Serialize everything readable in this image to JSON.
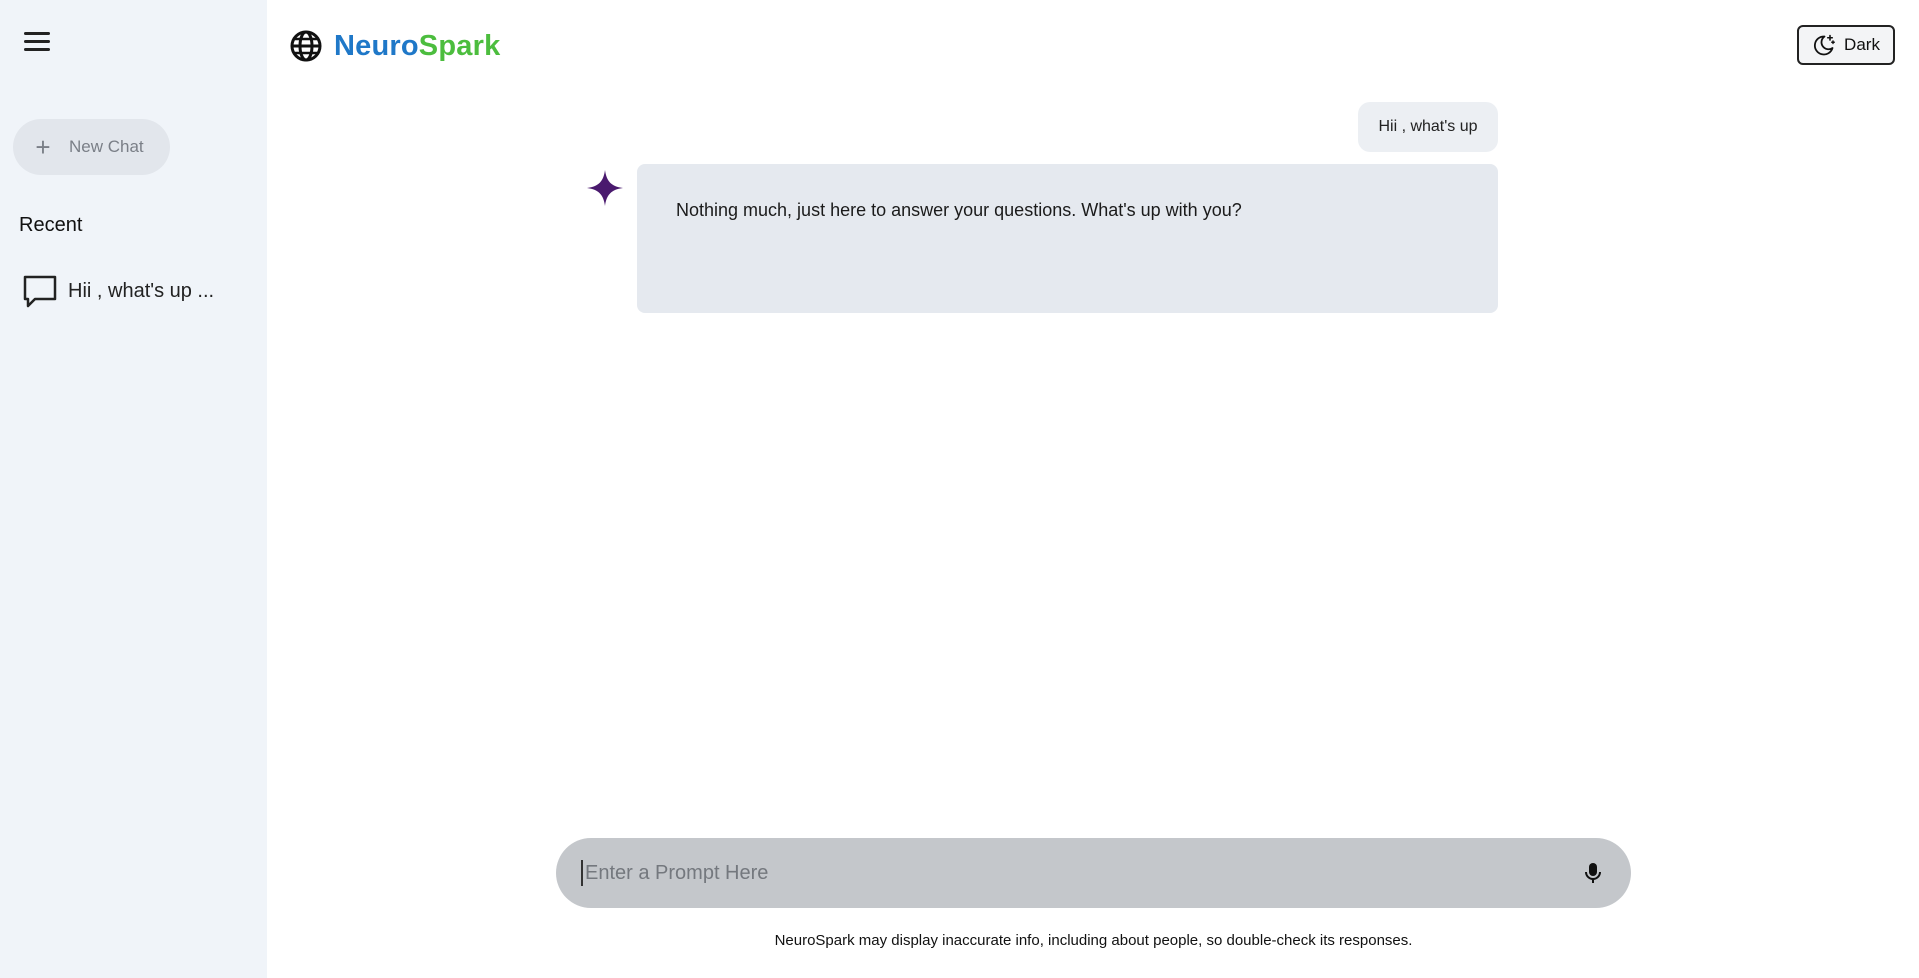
{
  "sidebar": {
    "new_chat_label": "New Chat",
    "recent_title": "Recent",
    "recent_items": [
      {
        "label": "Hii , what's up ..."
      }
    ]
  },
  "header": {
    "brand_part1": "Neuro",
    "brand_part2": "Spark",
    "theme_toggle_label": "Dark"
  },
  "chat": {
    "user_message": "Hii , what's up",
    "bot_message": "Nothing much, just here to answer your questions. What's up with you?"
  },
  "prompt": {
    "placeholder": "Enter a Prompt Here",
    "value": ""
  },
  "footer": {
    "disclaimer": "NeuroSpark may display inaccurate info, including about people, so double-check its responses."
  },
  "colors": {
    "brand_blue": "#1f78c8",
    "brand_green": "#4cbd3e",
    "sidebar_bg": "#f0f4f9",
    "bot_bubble_bg": "#e5e9ef",
    "prompt_bg": "#c4c7cb",
    "star_purple": "#4a1a6e"
  },
  "icons": {
    "menu": "hamburger-menu-icon",
    "new_chat": "plus-icon",
    "recent_item": "chat-bubble-icon",
    "logo": "globe-icon",
    "theme_toggle": "moon-stars-icon",
    "bot_avatar": "sparkle-star-icon",
    "mic": "microphone-icon"
  }
}
